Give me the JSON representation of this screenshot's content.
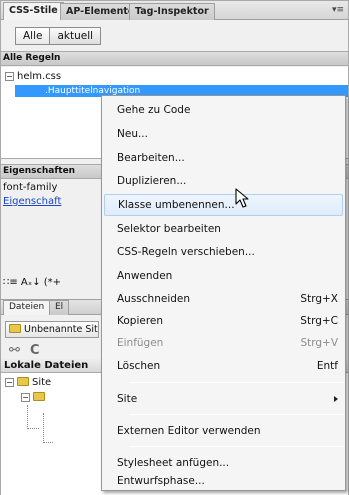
{
  "panel_tabs": [
    "CSS-Stile",
    "AP-Elemente",
    "Tag-Inspektor"
  ],
  "mode_buttons": [
    "Alle",
    "aktuell"
  ],
  "rules_header": "Alle Regeln",
  "tree": {
    "file": "helm.css",
    "selected_rule": ".Haupttitelnavigation"
  },
  "properties_header": "Eigenschaften",
  "property_rows": [
    "font-family",
    "Eigenschaft"
  ],
  "bottom_tools": "∷≡ Aₓ↓ (*+",
  "files_tabs": [
    "Dateien",
    "El"
  ],
  "site_dropdown": "Unbenannte Site",
  "local_header": "Lokale Dateien",
  "local_tree": [
    "Site",
    ""
  ],
  "menu": {
    "items": [
      {
        "label": "Gehe zu Code",
        "shortcut": "",
        "disabled": false,
        "submenu": false
      },
      {
        "label": "Neu...",
        "shortcut": "",
        "disabled": false,
        "submenu": false
      },
      {
        "label": "Bearbeiten...",
        "shortcut": "",
        "disabled": false,
        "submenu": false
      },
      {
        "label": "Duplizieren...",
        "shortcut": "",
        "disabled": false,
        "submenu": false
      },
      {
        "label": "Klasse umbenennen...",
        "shortcut": "",
        "disabled": false,
        "submenu": false,
        "hover": true
      },
      {
        "label": "Selektor bearbeiten",
        "shortcut": "",
        "disabled": false,
        "submenu": false
      },
      {
        "label": "CSS-Regeln verschieben...",
        "shortcut": "",
        "disabled": false,
        "submenu": false
      },
      {
        "label": "Anwenden",
        "shortcut": "",
        "disabled": false,
        "submenu": false
      },
      {
        "label": "Ausschneiden",
        "shortcut": "Strg+X",
        "disabled": false,
        "submenu": false
      },
      {
        "label": "Kopieren",
        "shortcut": "Strg+C",
        "disabled": false,
        "submenu": false
      },
      {
        "label": "Einfügen",
        "shortcut": "Strg+V",
        "disabled": true,
        "submenu": false
      },
      {
        "label": "Löschen",
        "shortcut": "Entf",
        "disabled": false,
        "submenu": false
      },
      {
        "label": "Site",
        "shortcut": "",
        "disabled": false,
        "submenu": true
      },
      {
        "label": "Externen Editor verwenden",
        "shortcut": "",
        "disabled": false,
        "submenu": false
      },
      {
        "label": "Stylesheet anfügen...",
        "shortcut": "",
        "disabled": false,
        "submenu": false
      },
      {
        "label": "Entwurfsphase...",
        "shortcut": "",
        "disabled": false,
        "submenu": false
      }
    ]
  }
}
